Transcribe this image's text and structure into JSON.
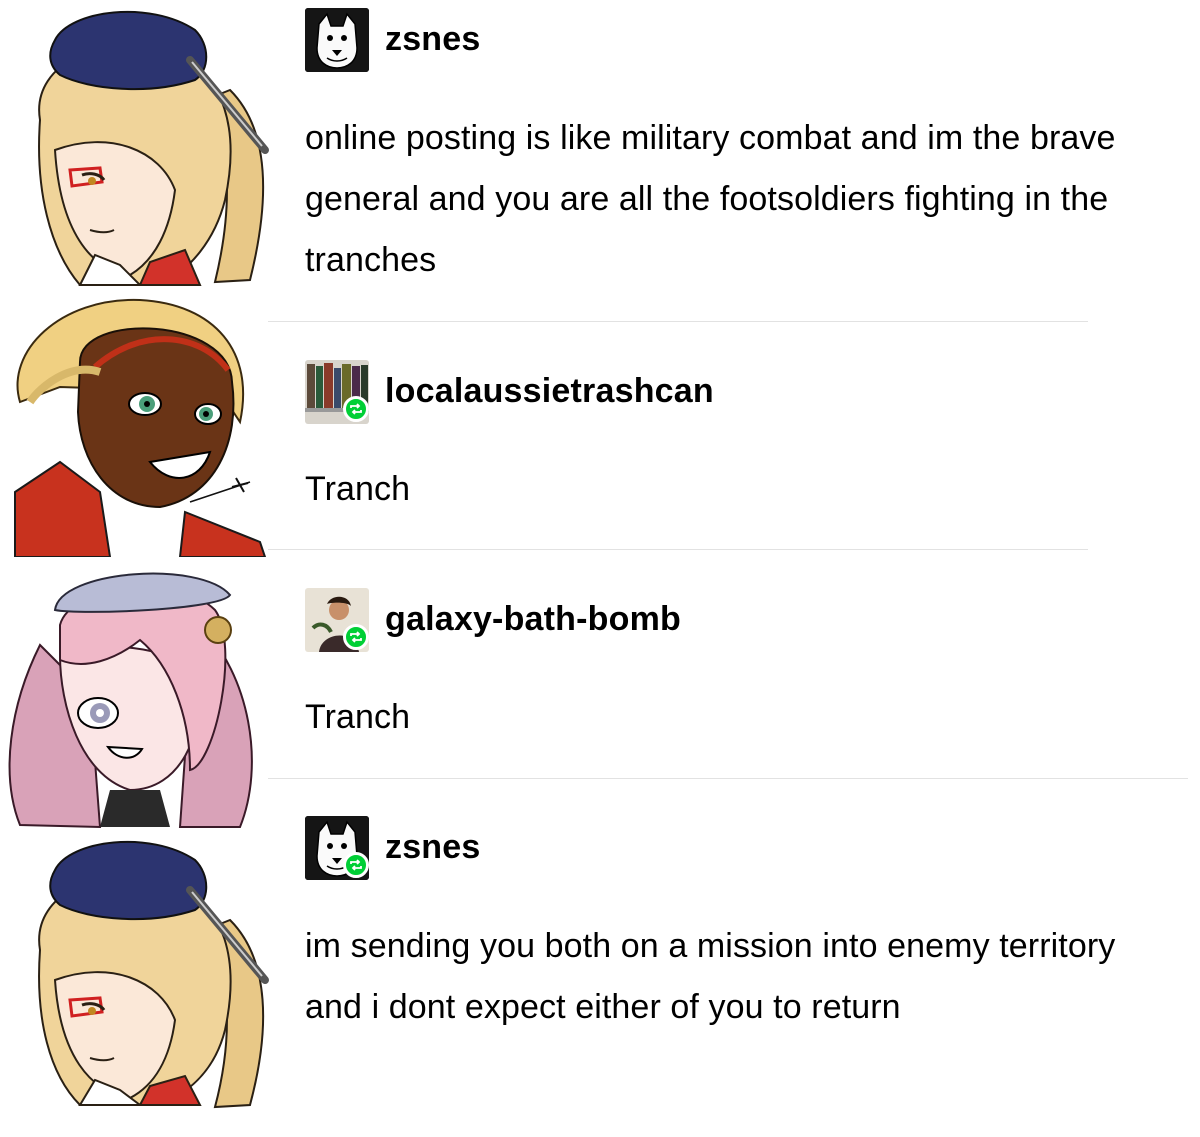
{
  "posts": [
    {
      "username": "zsnes",
      "text": "online posting is like military combat and im the brave general and you are all the footsoldiers fighting in the tranches",
      "reblog": false
    },
    {
      "username": "localaussietrashcan",
      "text": "Tranch",
      "reblog": true
    },
    {
      "username": "galaxy-bath-bomb",
      "text": "Tranch",
      "reblog": true
    },
    {
      "username": "zsnes",
      "text": "im sending you both on a mission into enemy territory and i dont expect either of you to return",
      "reblog": true
    }
  ],
  "portraits": [
    "blonde-general-portrait",
    "dark-skinned-soldier-portrait",
    "pink-haired-soldier-portrait",
    "blonde-general-portrait"
  ],
  "colors": {
    "reblog_badge": "#00cf35",
    "divider": "#e2e2e2",
    "text": "#000000"
  }
}
